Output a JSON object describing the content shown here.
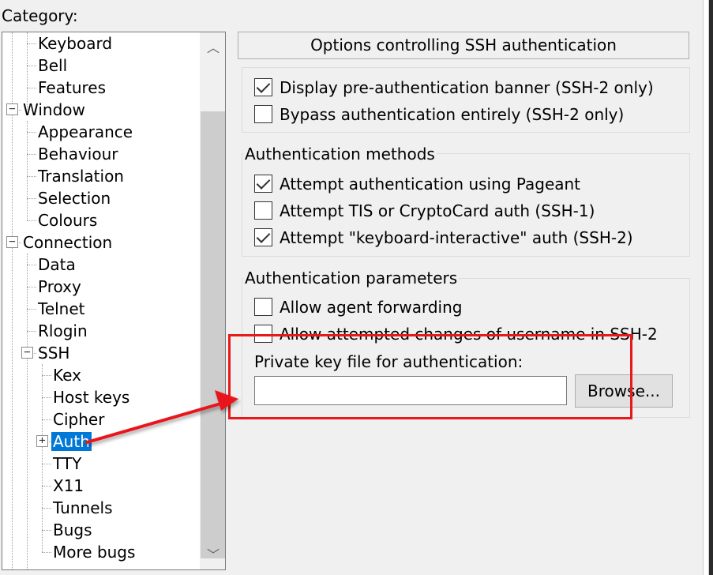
{
  "category_label": "Category:",
  "tree": {
    "items": [
      {
        "label": "Keyboard",
        "level": 2
      },
      {
        "label": "Bell",
        "level": 2
      },
      {
        "label": "Features",
        "level": 2
      },
      {
        "label": "Window",
        "level": 1,
        "expander": "−"
      },
      {
        "label": "Appearance",
        "level": 2
      },
      {
        "label": "Behaviour",
        "level": 2
      },
      {
        "label": "Translation",
        "level": 2
      },
      {
        "label": "Selection",
        "level": 2
      },
      {
        "label": "Colours",
        "level": 2
      },
      {
        "label": "Connection",
        "level": 1,
        "expander": "−"
      },
      {
        "label": "Data",
        "level": 2
      },
      {
        "label": "Proxy",
        "level": 2
      },
      {
        "label": "Telnet",
        "level": 2
      },
      {
        "label": "Rlogin",
        "level": 2
      },
      {
        "label": "SSH",
        "level": 2,
        "expander": "−"
      },
      {
        "label": "Kex",
        "level": 3
      },
      {
        "label": "Host keys",
        "level": 3
      },
      {
        "label": "Cipher",
        "level": 3
      },
      {
        "label": "Auth",
        "level": 3,
        "expander": "+",
        "selected": true
      },
      {
        "label": "TTY",
        "level": 3
      },
      {
        "label": "X11",
        "level": 3
      },
      {
        "label": "Tunnels",
        "level": 3
      },
      {
        "label": "Bugs",
        "level": 3
      },
      {
        "label": "More bugs",
        "level": 3
      }
    ],
    "scroll_up_icon": "chevron-up-icon",
    "scroll_down_icon": "chevron-down-icon"
  },
  "panel": {
    "header": "Options controlling SSH authentication",
    "banner_group": {
      "options": [
        {
          "label": "Display pre-authentication banner (SSH-2 only)",
          "checked": true
        },
        {
          "label": "Bypass authentication entirely (SSH-2 only)",
          "checked": false
        }
      ]
    },
    "methods_group": {
      "title": "Authentication methods",
      "options": [
        {
          "label": "Attempt authentication using Pageant",
          "checked": true
        },
        {
          "label": "Attempt TIS or CryptoCard auth (SSH-1)",
          "checked": false
        },
        {
          "label": "Attempt \"keyboard-interactive\" auth (SSH-2)",
          "checked": true
        }
      ]
    },
    "params_group": {
      "title": "Authentication parameters",
      "options": [
        {
          "label": "Allow agent forwarding",
          "checked": false
        },
        {
          "label": "Allow attempted changes of username in SSH-2",
          "checked": false
        }
      ],
      "key_file_label": "Private key file for authentication:",
      "key_file_value": "",
      "browse_label": "Browse..."
    }
  },
  "annotation": {
    "color": "#e8191c"
  }
}
